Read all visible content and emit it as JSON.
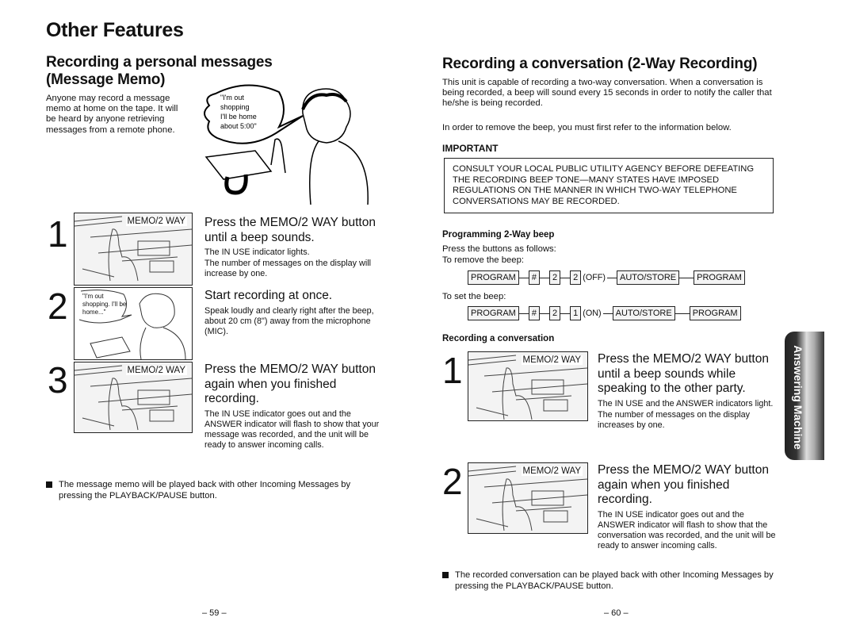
{
  "left_page": {
    "title": "Other Features",
    "section_title_line1": "Recording a personal messages",
    "section_title_line2": "(Message Memo)",
    "intro": "Anyone may record a message memo at home on the tape. It will be heard by anyone retrieving messages from a remote phone.",
    "illustration_bubble": "\"I'm out shopping. I'll be home about 5:00.\"",
    "steps": [
      {
        "number": "1",
        "panel_label": "MEMO/2 WAY",
        "heading": "Press the MEMO/2 WAY button until a beep sounds.",
        "body_lines": [
          "The IN USE indicator lights.",
          "The number of messages on the display will increase by one."
        ]
      },
      {
        "number": "2",
        "panel_bubble": "\"I'm out shopping. I'll be home...\"",
        "heading": "Start recording at once.",
        "body_lines": [
          "Speak loudly and clearly right after the beep, about 20 cm (8\") away from the microphone (MIC)."
        ]
      },
      {
        "number": "3",
        "panel_label": "MEMO/2 WAY",
        "heading": "Press the MEMO/2 WAY button again when you finished recording.",
        "body_lines": [
          "The IN USE indicator goes out and the ANSWER indicator will flash to show that your message was recorded, and the unit will be ready to answer incoming calls."
        ]
      }
    ],
    "bullet_note": "The message memo will be played back with other Incoming Messages by pressing the PLAYBACK/PAUSE button.",
    "page_number": "– 59 –"
  },
  "right_page": {
    "section_title": "Recording a conversation (2-Way Recording)",
    "intro": "This unit is capable of recording a two-way conversation. When a conversation is being recorded, a beep will sound every 15 seconds in order to notify the caller that he/she is being recorded.",
    "intro2": "In order to remove the beep, you must first refer to the information below.",
    "important_label": "IMPORTANT",
    "important_text": "CONSULT YOUR LOCAL PUBLIC UTILITY AGENCY BEFORE DEFEATING THE RECORDING BEEP TONE—MANY STATES HAVE IMPOSED REGULATIONS ON THE MANNER IN WHICH TWO-WAY TELEPHONE CONVERSATIONS MAY BE RECORDED.",
    "programming_title": "Programming 2-Way beep",
    "programming_intro": "Press the buttons as follows:",
    "remove_label": "To remove the beep:",
    "remove_sequence": [
      "PROGRAM",
      "#",
      "2",
      "2"
    ],
    "remove_note": "(OFF)",
    "remove_tail": [
      "AUTO/STORE",
      "PROGRAM"
    ],
    "set_label": "To set the beep:",
    "set_sequence": [
      "PROGRAM",
      "#",
      "2",
      "1"
    ],
    "set_note": "(ON)",
    "set_tail": [
      "AUTO/STORE",
      "PROGRAM"
    ],
    "recording_title": "Recording a conversation",
    "steps": [
      {
        "number": "1",
        "panel_label": "MEMO/2 WAY",
        "heading": "Press the MEMO/2 WAY button until a beep sounds while speaking to the other party.",
        "body_lines": [
          "The IN USE and the ANSWER indicators light.",
          "The number of messages on the display increases by one."
        ]
      },
      {
        "number": "2",
        "panel_label": "MEMO/2 WAY",
        "heading": "Press the MEMO/2 WAY button again when you finished recording.",
        "body_lines": [
          "The IN USE indicator goes out and the ANSWER indicator will flash to show that the conversation was recorded, and the unit will be ready to answer incoming calls."
        ]
      }
    ],
    "bullet_note": "The recorded conversation can be played back with other Incoming Messages by pressing the PLAYBACK/PAUSE button.",
    "side_tab": "Answering Machine",
    "page_number": "– 60 –"
  }
}
